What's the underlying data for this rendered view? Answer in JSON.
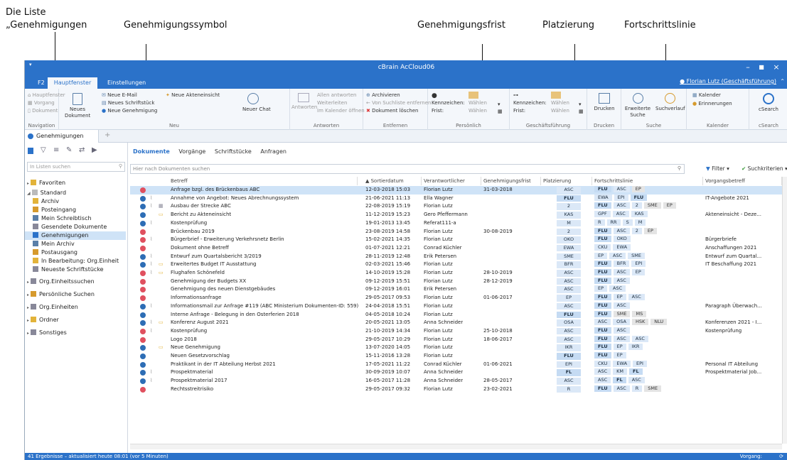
{
  "annotations": [
    "Die Liste",
    "„Genehmigungen",
    "Genehmigungssymbol",
    "Genehmigungsfrist",
    "Platzierung",
    "Fortschrittslinie"
  ],
  "window": {
    "title": "cBrain AcCloud06",
    "user": "Florian Lutz (Geschäftsführung)"
  },
  "ribbon_tabs": [
    "F2",
    "Hauptfenster",
    "Einstellungen"
  ],
  "ribbon": {
    "navigation": {
      "items": [
        "Hauptfenster",
        "Vorgang",
        "Dokument"
      ],
      "label": "Navigation"
    },
    "neu": {
      "big": "Neues Dokument",
      "items": [
        "Neue E-Mail",
        "Neues Schriftstück",
        "Neue Genehmigung"
      ],
      "item2": "Neue Akteneinsicht",
      "chat": "Neuer Chat",
      "label": "Neu"
    },
    "antworten": {
      "big": "Antworten",
      "items": [
        "Allen antworten",
        "Weiterleiten",
        "Im Kalender öffnen"
      ],
      "label": "Antworten"
    },
    "entfernen": {
      "items": [
        "Archivieren",
        "Von Suchliste entfernen",
        "Dokument löschen"
      ],
      "label": "Entfernen"
    },
    "persoenlich": {
      "k": "Kennzeichen:",
      "f": "Frist:",
      "w": "Wählen",
      "label": "Persönlich"
    },
    "geschaeft": {
      "k": "Kennzeichen:",
      "f": "Frist:",
      "w": "Wählen",
      "label": "Geschäftsführung"
    },
    "drucken": {
      "big": "Drucken",
      "label": "Drucken"
    },
    "suche": {
      "items": [
        "Erweiterte Suche",
        "Suchverlauf"
      ],
      "label": "Suche"
    },
    "kalender": {
      "items": [
        "Kalender",
        "Erinnerungen"
      ],
      "label": "Kalender"
    },
    "csearch": {
      "big": "cSearch",
      "label": "cSearch"
    }
  },
  "doc_tab": "Genehmigungen",
  "left": {
    "search_placeholder": "In Listen suchen",
    "tree": [
      "Favoriten",
      "Standard",
      "Archiv",
      "Posteingang",
      "Mein Schreibtisch",
      "Gesendete Dokumente",
      "Genehmigungen",
      "Mein Archiv",
      "Postausgang",
      "In Bearbeitung: Org.Einheit",
      "Neueste Schriftstücke",
      "Org.Einheitssuchen",
      "Persönliche Suchen",
      "Org.Einheiten",
      "Ordner",
      "Sonstiges"
    ]
  },
  "subtabs": [
    "Dokumente",
    "Vorgänge",
    "Schriftstücke",
    "Anfragen"
  ],
  "search_placeholder": "Hier nach Dokumenten suchen",
  "filter_label": "Filter",
  "criteria_label": "Suchkriterien",
  "columns": [
    "Betreff",
    "Sortierdatum",
    "Verantwortlicher",
    "Genehmigungsfrist",
    "Platzierung",
    "Fortschrittslinie",
    "Vorgangsbetreff"
  ],
  "rows": [
    {
      "s": "red",
      "a": 0,
      "t": 0,
      "b": "Anfrage bzgl. des Brückenbaus ABC",
      "d": "12-03-2018 15:03",
      "v": "Florian Lutz",
      "f": "31-03-2018",
      "p": "ASC",
      "pb": 0,
      "fl": [
        [
          "FLU",
          1
        ],
        [
          "ASC",
          0
        ],
        [
          "EP",
          2
        ]
      ],
      "vb": ""
    },
    {
      "s": "blue",
      "a": 1,
      "t": 0,
      "b": "Annahme von Angebot: Neues Abrechnungssystem",
      "d": "21-06-2021 11:13",
      "v": "Ella Wagner",
      "f": "",
      "p": "FLU",
      "pb": 1,
      "fl": [
        [
          "EWA",
          0
        ],
        [
          "EPI",
          0
        ],
        [
          "FLU",
          1
        ]
      ],
      "vb": "IT-Angebote 2021"
    },
    {
      "s": "blue",
      "a": 1,
      "t": 2,
      "b": "Ausbau der Strecke ABC",
      "d": "22-08-2019 15:19",
      "v": "Florian Lutz",
      "f": "",
      "p": "2",
      "pb": 0,
      "fl": [
        [
          "FLU",
          1
        ],
        [
          "ASC",
          0
        ],
        [
          "2",
          0
        ],
        [
          "SME",
          2
        ],
        [
          "EP",
          2
        ]
      ],
      "vb": ""
    },
    {
      "s": "blue",
      "a": 0,
      "t": 1,
      "b": "Bericht zu Akteneinsicht",
      "d": "11-12-2019 15:23",
      "v": "Gero Pfeffermann",
      "f": "",
      "p": "KAS",
      "pb": 0,
      "fl": [
        [
          "GPF",
          0
        ],
        [
          "ASC",
          0
        ],
        [
          "KAS",
          0
        ]
      ],
      "vb": "Akteneinsicht - Deze..."
    },
    {
      "s": "blue",
      "a": 1,
      "t": 0,
      "b": "Kostenprüfung",
      "d": "19-01-2013 13:45",
      "v": "Referat111-a",
      "f": "",
      "p": "M",
      "pb": 0,
      "fl": [
        [
          "R",
          0
        ],
        [
          "RR",
          0
        ],
        [
          "S",
          0
        ],
        [
          "M",
          0
        ]
      ],
      "vb": ""
    },
    {
      "s": "red",
      "a": 0,
      "t": 0,
      "b": "Brückenbau 2019",
      "d": "23-08-2019 14:58",
      "v": "Florian Lutz",
      "f": "30-08-2019",
      "p": "2",
      "pb": 0,
      "fl": [
        [
          "FLU",
          1
        ],
        [
          "ASC",
          0
        ],
        [
          "2",
          0
        ],
        [
          "EP",
          2
        ]
      ],
      "vb": ""
    },
    {
      "s": "red",
      "a": 1,
      "t": 0,
      "b": "Bürgerbrief - Erweiterung Verkehrsnetz Berlin",
      "d": "15-02-2021 14:35",
      "v": "Florian Lutz",
      "f": "",
      "p": "OKO",
      "pb": 0,
      "fl": [
        [
          "FLU",
          1
        ],
        [
          "OKO",
          0
        ]
      ],
      "vb": "Bürgerbriefe"
    },
    {
      "s": "red",
      "a": 0,
      "t": 0,
      "b": "Dokument ohne Betreff",
      "d": "01-07-2021 12:21",
      "v": "Conrad Küchler",
      "f": "",
      "p": "EWA",
      "pb": 0,
      "fl": [
        [
          "CKU",
          0
        ],
        [
          "EWA",
          0
        ]
      ],
      "vb": "Anschaffungen 2021"
    },
    {
      "s": "blue",
      "a": 1,
      "t": 0,
      "b": "Entwurf zum Quartalsbericht 3/2019",
      "d": "28-11-2019 12:48",
      "v": "Erik Petersen",
      "f": "",
      "p": "SME",
      "pb": 0,
      "fl": [
        [
          "EP",
          0
        ],
        [
          "ASC",
          0
        ],
        [
          "SME",
          0
        ]
      ],
      "vb": "Entwurf zum Quartal..."
    },
    {
      "s": "blue",
      "a": 1,
      "t": 1,
      "b": "Erweitertes Budget IT Ausstattung",
      "d": "02-03-2021 15:46",
      "v": "Florian Lutz",
      "f": "",
      "p": "BFR",
      "pb": 0,
      "fl": [
        [
          "FLU",
          1
        ],
        [
          "BFR",
          0
        ],
        [
          "EPI",
          0
        ]
      ],
      "vb": "IT Beschaffung 2021"
    },
    {
      "s": "red",
      "a": 1,
      "t": 1,
      "b": "Flughafen Schönefeld",
      "d": "14-10-2019 15:28",
      "v": "Florian Lutz",
      "f": "28-10-2019",
      "p": "ASC",
      "pb": 0,
      "fl": [
        [
          "FLU",
          1
        ],
        [
          "ASC",
          0
        ],
        [
          "EP",
          0
        ]
      ],
      "vb": ""
    },
    {
      "s": "red",
      "a": 0,
      "t": 0,
      "b": "Genehmigung der Budgets XX",
      "d": "09-12-2019 15:51",
      "v": "Florian Lutz",
      "f": "28-12-2019",
      "p": "ASC",
      "pb": 0,
      "fl": [
        [
          "FLU",
          1
        ],
        [
          "ASC",
          0
        ]
      ],
      "vb": ""
    },
    {
      "s": "red",
      "a": 0,
      "t": 0,
      "b": "Genehmigung des neuen Dienstgebäudes",
      "d": "09-12-2019 16:01",
      "v": "Erik Petersen",
      "f": "",
      "p": "ASC",
      "pb": 0,
      "fl": [
        [
          "EP",
          0
        ],
        [
          "ASC",
          0
        ]
      ],
      "vb": ""
    },
    {
      "s": "red",
      "a": 0,
      "t": 0,
      "b": "Informationsanfrage",
      "d": "29-05-2017 09:53",
      "v": "Florian Lutz",
      "f": "01-06-2017",
      "p": "EP",
      "pb": 0,
      "fl": [
        [
          "FLU",
          1
        ],
        [
          "EP",
          0
        ],
        [
          "ASC",
          0
        ]
      ],
      "vb": ""
    },
    {
      "s": "blue",
      "a": 1,
      "t": 0,
      "b": "Informationsmail zur Anfrage #119 (ABC Ministerium Dokumenten-ID: 559)",
      "d": "24-04-2018 15:51",
      "v": "Florian Lutz",
      "f": "",
      "p": "ASC",
      "pb": 0,
      "fl": [
        [
          "FLU",
          1
        ],
        [
          "ASC",
          0
        ]
      ],
      "vb": "Paragraph Überwach..."
    },
    {
      "s": "blue",
      "a": 0,
      "t": 0,
      "b": "Interne Anfrage - Belegung in den Osterferien 2018",
      "d": "04-05-2018 10:24",
      "v": "Florian Lutz",
      "f": "",
      "p": "FLU",
      "pb": 1,
      "fl": [
        [
          "FLU",
          1
        ],
        [
          "SME",
          2
        ],
        [
          "MS",
          2
        ]
      ],
      "vb": ""
    },
    {
      "s": "blue",
      "a": 1,
      "t": 1,
      "b": "Konferenz August 2021",
      "d": "20-05-2021 13:05",
      "v": "Anna Schneider",
      "f": "",
      "p": "OSA",
      "pb": 0,
      "fl": [
        [
          "ASC",
          0
        ],
        [
          "OSA",
          0
        ],
        [
          "HSK",
          2
        ],
        [
          "NLU",
          2
        ]
      ],
      "vb": "Konferenzen 2021 - I..."
    },
    {
      "s": "red",
      "a": 1,
      "t": 0,
      "b": "Kostenprüfung",
      "d": "21-10-2019 14:34",
      "v": "Florian Lutz",
      "f": "25-10-2018",
      "p": "ASC",
      "pb": 0,
      "fl": [
        [
          "FLU",
          1
        ],
        [
          "ASC",
          0
        ]
      ],
      "vb": "Kostenprüfung"
    },
    {
      "s": "red",
      "a": 0,
      "t": 0,
      "b": "Logo 2018",
      "d": "29-05-2017 10:29",
      "v": "Florian Lutz",
      "f": "18-06-2017",
      "p": "ASC",
      "pb": 0,
      "fl": [
        [
          "FLU",
          1
        ],
        [
          "ASC",
          0
        ],
        [
          "ASC",
          0
        ]
      ],
      "vb": ""
    },
    {
      "s": "blue",
      "a": 0,
      "t": 1,
      "b": "Neue Genehmigung",
      "d": "13-07-2020 14:05",
      "v": "Florian Lutz",
      "f": "",
      "p": "IKR",
      "pb": 0,
      "fl": [
        [
          "FLU",
          1
        ],
        [
          "EP",
          0
        ],
        [
          "IKR",
          0
        ]
      ],
      "vb": ""
    },
    {
      "s": "blue",
      "a": 0,
      "t": 0,
      "b": "Neuen Gesetzvorschlag",
      "d": "15-11-2016 13:28",
      "v": "Florian Lutz",
      "f": "",
      "p": "FLU",
      "pb": 1,
      "fl": [
        [
          "FLU",
          1
        ],
        [
          "EP",
          0
        ]
      ],
      "vb": ""
    },
    {
      "s": "blue",
      "a": 0,
      "t": 0,
      "b": "Praktikant in der IT Abteilung Herbst 2021",
      "d": "17-05-2021 11:22",
      "v": "Conrad Küchler",
      "f": "01-06-2021",
      "p": "EPI",
      "pb": 0,
      "fl": [
        [
          "CKU",
          0
        ],
        [
          "EWA",
          0
        ],
        [
          "EPI",
          0
        ]
      ],
      "vb": "Personal IT Abteilung"
    },
    {
      "s": "blue",
      "a": 1,
      "t": 0,
      "b": "Prospektmaterial",
      "d": "30-09-2019 10:07",
      "v": "Anna Schneider",
      "f": "",
      "p": "FL",
      "pb": 1,
      "fl": [
        [
          "ASC",
          0
        ],
        [
          "KM",
          0
        ],
        [
          "FL",
          1
        ]
      ],
      "vb": "Prospektmaterial Job..."
    },
    {
      "s": "blue",
      "a": 1,
      "t": 0,
      "b": "Prospektmaterial 2017",
      "d": "16-05-2017 11:28",
      "v": "Anna Schneider",
      "f": "28-05-2017",
      "p": "ASC",
      "pb": 0,
      "fl": [
        [
          "ASC",
          0
        ],
        [
          "FL",
          1
        ],
        [
          "ASC",
          0
        ]
      ],
      "vb": ""
    },
    {
      "s": "red",
      "a": 0,
      "t": 0,
      "b": "Rechtsstreitrisiko",
      "d": "29-05-2017 09:32",
      "v": "Florian Lutz",
      "f": "23-02-2021",
      "p": "R",
      "pb": 0,
      "fl": [
        [
          "FLU",
          1
        ],
        [
          "ASC",
          0
        ],
        [
          "R",
          0
        ],
        [
          "SME",
          2
        ]
      ],
      "vb": ""
    }
  ],
  "status": {
    "left": "41 Ergebnisse – aktualisiert heute 08:01 (vor 5 Minuten)",
    "right": "Vorgang:"
  },
  "colors": {
    "accent": "#2b72c9",
    "approved": "#2d6db5",
    "rejected": "#e0505f",
    "selected_row": "#cfe3f7"
  }
}
